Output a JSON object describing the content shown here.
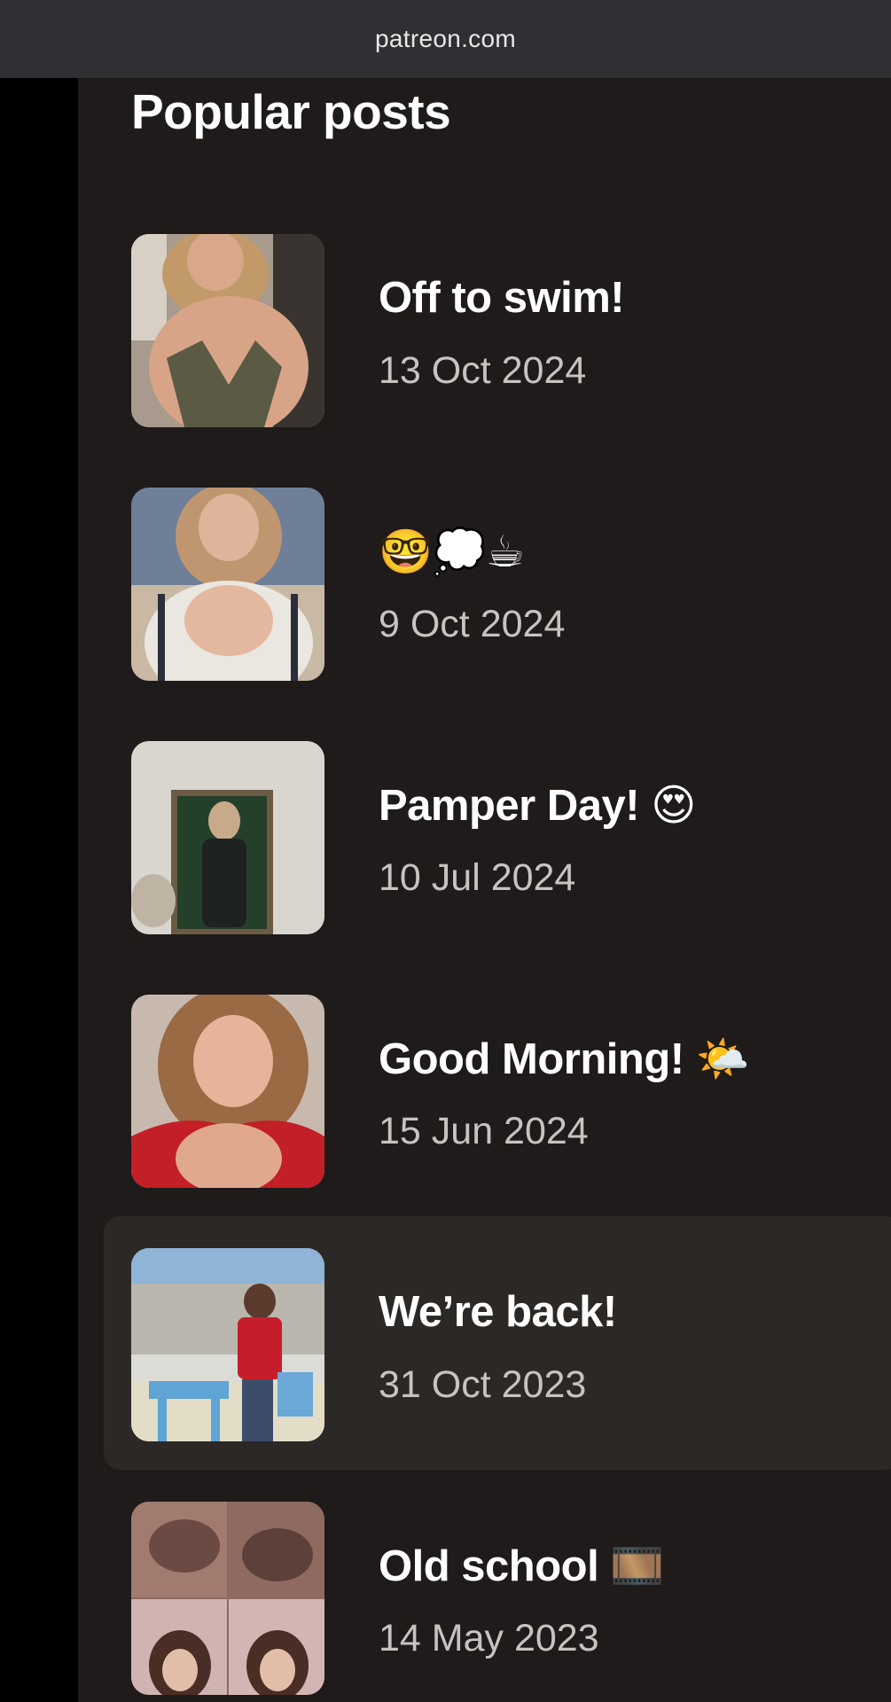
{
  "browser": {
    "url": "patreon.com"
  },
  "section": {
    "title": "Popular posts"
  },
  "posts": [
    {
      "title": "Off to swim!",
      "date": "13 Oct 2024",
      "thumbnail_alt": "post photo"
    },
    {
      "title": "🤓💭☕",
      "date": "9 Oct 2024",
      "thumbnail_alt": "post photo"
    },
    {
      "title": "Pamper Day! 😍",
      "date": "10 Jul 2024",
      "thumbnail_alt": "post photo"
    },
    {
      "title": "Good Morning! 🌤️",
      "date": "15 Jun 2024",
      "thumbnail_alt": "post photo"
    },
    {
      "title": "We’re back!",
      "date": "31 Oct 2023",
      "thumbnail_alt": "post photo"
    },
    {
      "title": "Old school 🎞️",
      "date": "14 May 2023",
      "thumbnail_alt": "post photo"
    }
  ],
  "colors": {
    "page_background": "#1e1b1a",
    "url_bar": "#2f3033",
    "highlight_row": "#2b2826",
    "title_text": "#ffffff",
    "date_text": "#c6c3c0"
  }
}
